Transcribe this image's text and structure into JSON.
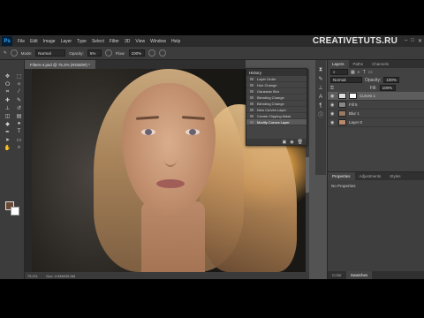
{
  "app": {
    "logo": "Ps",
    "menu": [
      "File",
      "Edit",
      "Image",
      "Layer",
      "Type",
      "Select",
      "Filter",
      "3D",
      "View",
      "Window",
      "Help"
    ],
    "watermark": "CREATIVETUTS.RU"
  },
  "options_bar": {
    "mode_label": "Mode:",
    "mode_value": "Normal",
    "opacity_label": "Opacity:",
    "opacity_value": "5%",
    "flow_label": "Flow:",
    "flow_value": "100%"
  },
  "document": {
    "tab_title": "Filters-4.psd @ 75.2% (RGB/8#) *",
    "zoom": "75.2%",
    "doc_info": "Doc: 4.94M/26.5M"
  },
  "history": {
    "title": "History",
    "items": [
      "Layer Order",
      "Hue Change",
      "Gaussian Blur",
      "Blending Change",
      "Blending Change",
      "New Curves Layer",
      "Create Clipping Mask",
      "Modify Curves Layer"
    ],
    "active_index": 7
  },
  "layers": {
    "tabs": [
      "Layers",
      "Paths",
      "Channels"
    ],
    "blend_mode": "Normal",
    "opacity_label": "Opacity:",
    "opacity_value": "100%",
    "fill_label": "Fill:",
    "fill_value": "100%",
    "rows": [
      {
        "name": "Curves 1"
      },
      {
        "name": "Fill 5"
      },
      {
        "name": "Blur 1"
      },
      {
        "name": "Layer 0"
      }
    ],
    "selected_index": 0
  },
  "properties": {
    "tabs": [
      "Properties",
      "Adjustments",
      "Styles"
    ],
    "body": "No Properties",
    "bottom_tabs": [
      "Color",
      "Swatches"
    ]
  },
  "colors": {
    "foreground": "#6b4a35",
    "background": "#ffffff"
  }
}
